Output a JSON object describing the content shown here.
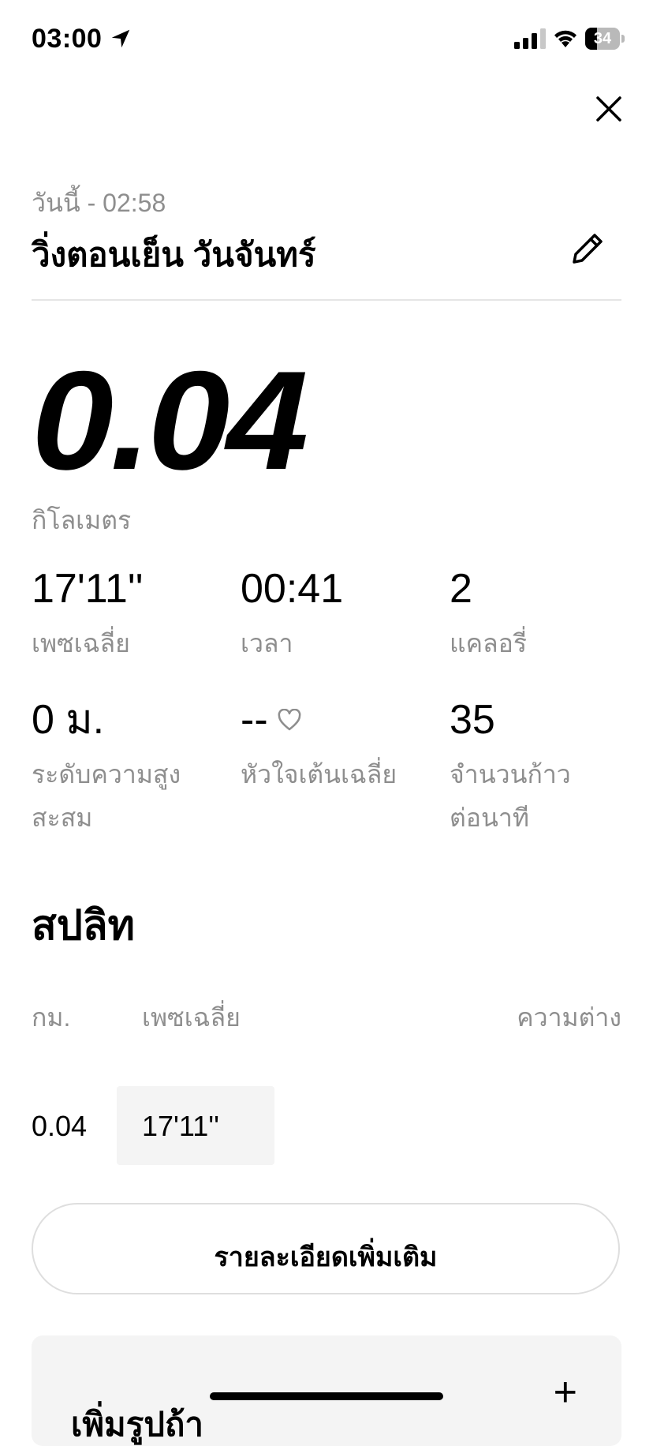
{
  "status_bar": {
    "time": "03:00",
    "battery_level": "34",
    "battery_percent": 34,
    "icons": [
      "location-arrow-icon",
      "signal-icon",
      "wifi-icon",
      "battery-icon"
    ]
  },
  "header": {
    "close_icon": "close-icon",
    "date": "วันนี้ - 02:58",
    "title": "วิ่งตอนเย็น วันจันทร์",
    "edit_icon": "pencil-icon"
  },
  "summary": {
    "distance": "0.04",
    "distance_unit": "กิโลเมตร"
  },
  "stats": [
    {
      "value": "17'11''",
      "label": "เพซเฉลี่ย"
    },
    {
      "value": "00:41",
      "label": "เวลา"
    },
    {
      "value": "2",
      "label": "แคลอรี่"
    },
    {
      "value": "0 ม.",
      "label": "ระดับความสูงสะสม"
    },
    {
      "value": "--",
      "label": "หัวใจเต้นเฉลี่ย",
      "icon": "heart-icon"
    },
    {
      "value": "35",
      "label": "จำนวนก้าวต่อนาที"
    }
  ],
  "splits": {
    "title": "สปลิท",
    "columns": [
      "กม.",
      "เพซเฉลี่ย",
      "ความต่าง"
    ],
    "rows": [
      {
        "km": "0.04",
        "pace": "17'11''",
        "diff": ""
      }
    ]
  },
  "more_details_label": "รายละเอียดเพิ่มเติม",
  "card": {
    "text": "เพิ่มรูปถ้า",
    "add_icon": "plus-icon",
    "add_symbol": "+"
  }
}
